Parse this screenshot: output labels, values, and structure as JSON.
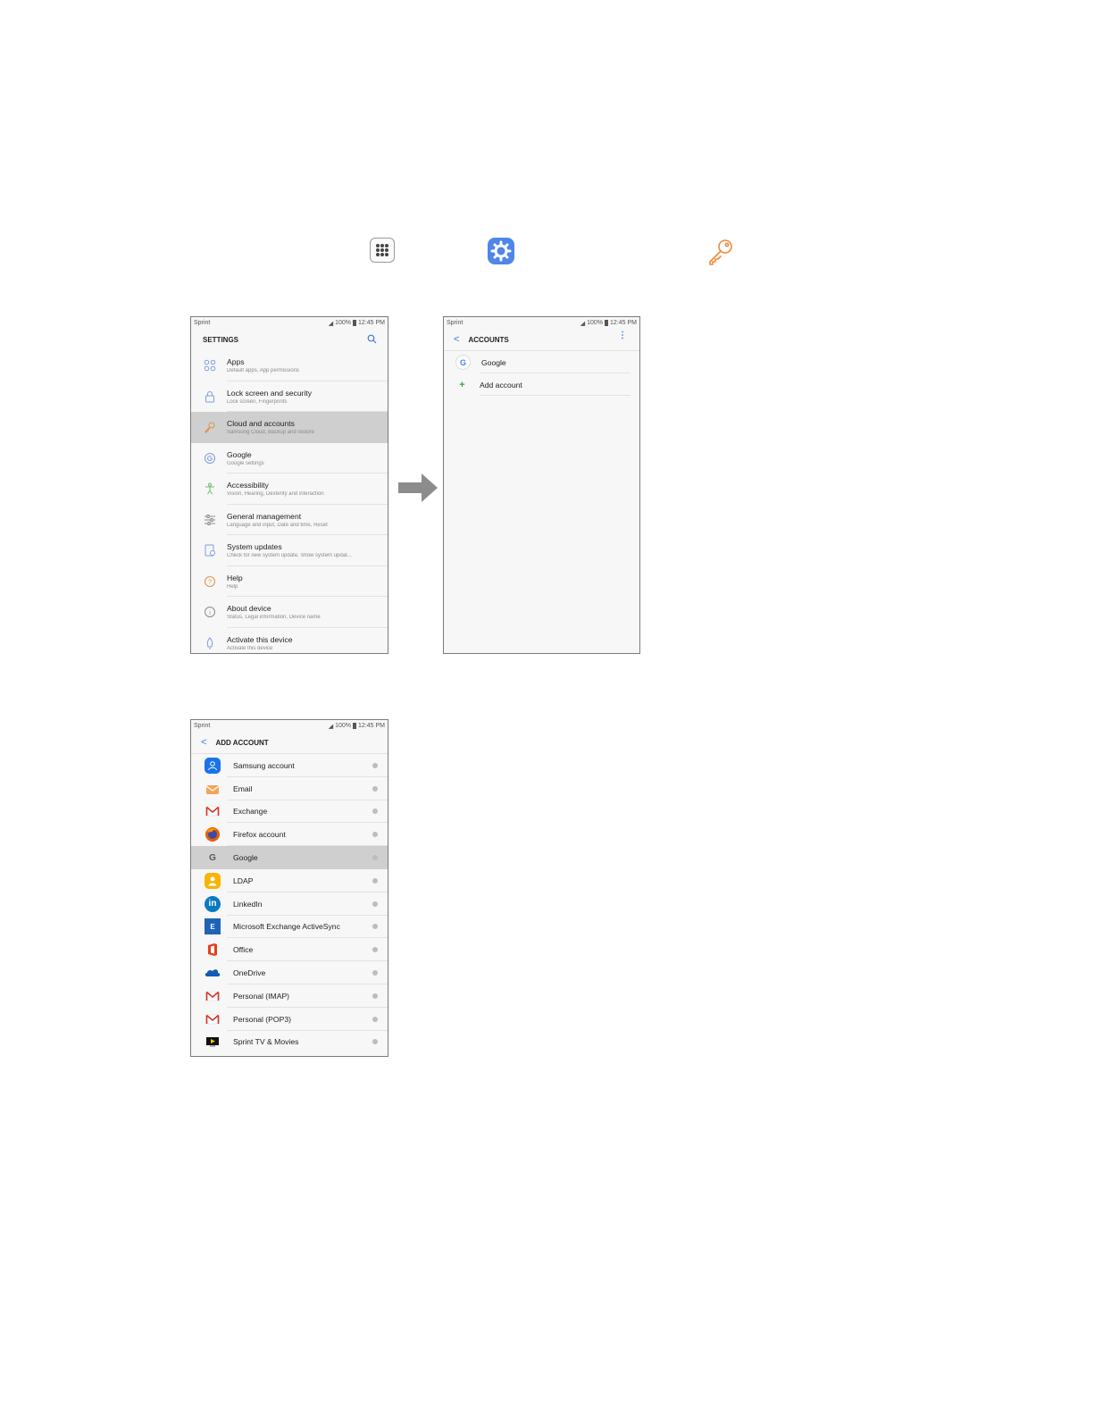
{
  "icons": {
    "apps": "apps-icon",
    "settings": "settings-icon",
    "key": "key-icon",
    "arrow": "right-arrow-icon"
  },
  "status": {
    "carrier": "Sprint",
    "battery": "100%",
    "time": "12:45 PM"
  },
  "settings_screen": {
    "title": "SETTINGS",
    "items": [
      {
        "label": "Apps",
        "sub": "Default apps, App permissions"
      },
      {
        "label": "Lock screen and security",
        "sub": "Lock screen, Fingerprints"
      },
      {
        "label": "Cloud and accounts",
        "sub": "Samsung Cloud, Backup and restore"
      },
      {
        "label": "Google",
        "sub": "Google settings"
      },
      {
        "label": "Accessibility",
        "sub": "Vision, Hearing, Dexterity and interaction"
      },
      {
        "label": "General management",
        "sub": "Language and input, Date and time, Reset"
      },
      {
        "label": "System updates",
        "sub": "Check for new system update, Show system updat..."
      },
      {
        "label": "Help",
        "sub": "Help"
      },
      {
        "label": "About device",
        "sub": "Status, Legal information, Device name"
      },
      {
        "label": "Activate this device",
        "sub": "Activate this device"
      }
    ]
  },
  "accounts_screen": {
    "title": "ACCOUNTS",
    "items": [
      {
        "label": "Google"
      },
      {
        "label": "Add account"
      }
    ]
  },
  "add_account_screen": {
    "title": "ADD ACCOUNT",
    "items": [
      {
        "label": "Samsung account"
      },
      {
        "label": "Email"
      },
      {
        "label": "Exchange"
      },
      {
        "label": "Firefox account"
      },
      {
        "label": "Google"
      },
      {
        "label": "LDAP"
      },
      {
        "label": "LinkedIn"
      },
      {
        "label": "Microsoft Exchange ActiveSync"
      },
      {
        "label": "Office"
      },
      {
        "label": "OneDrive"
      },
      {
        "label": "Personal (IMAP)"
      },
      {
        "label": "Personal (POP3)"
      },
      {
        "label": "Sprint TV & Movies"
      }
    ]
  }
}
